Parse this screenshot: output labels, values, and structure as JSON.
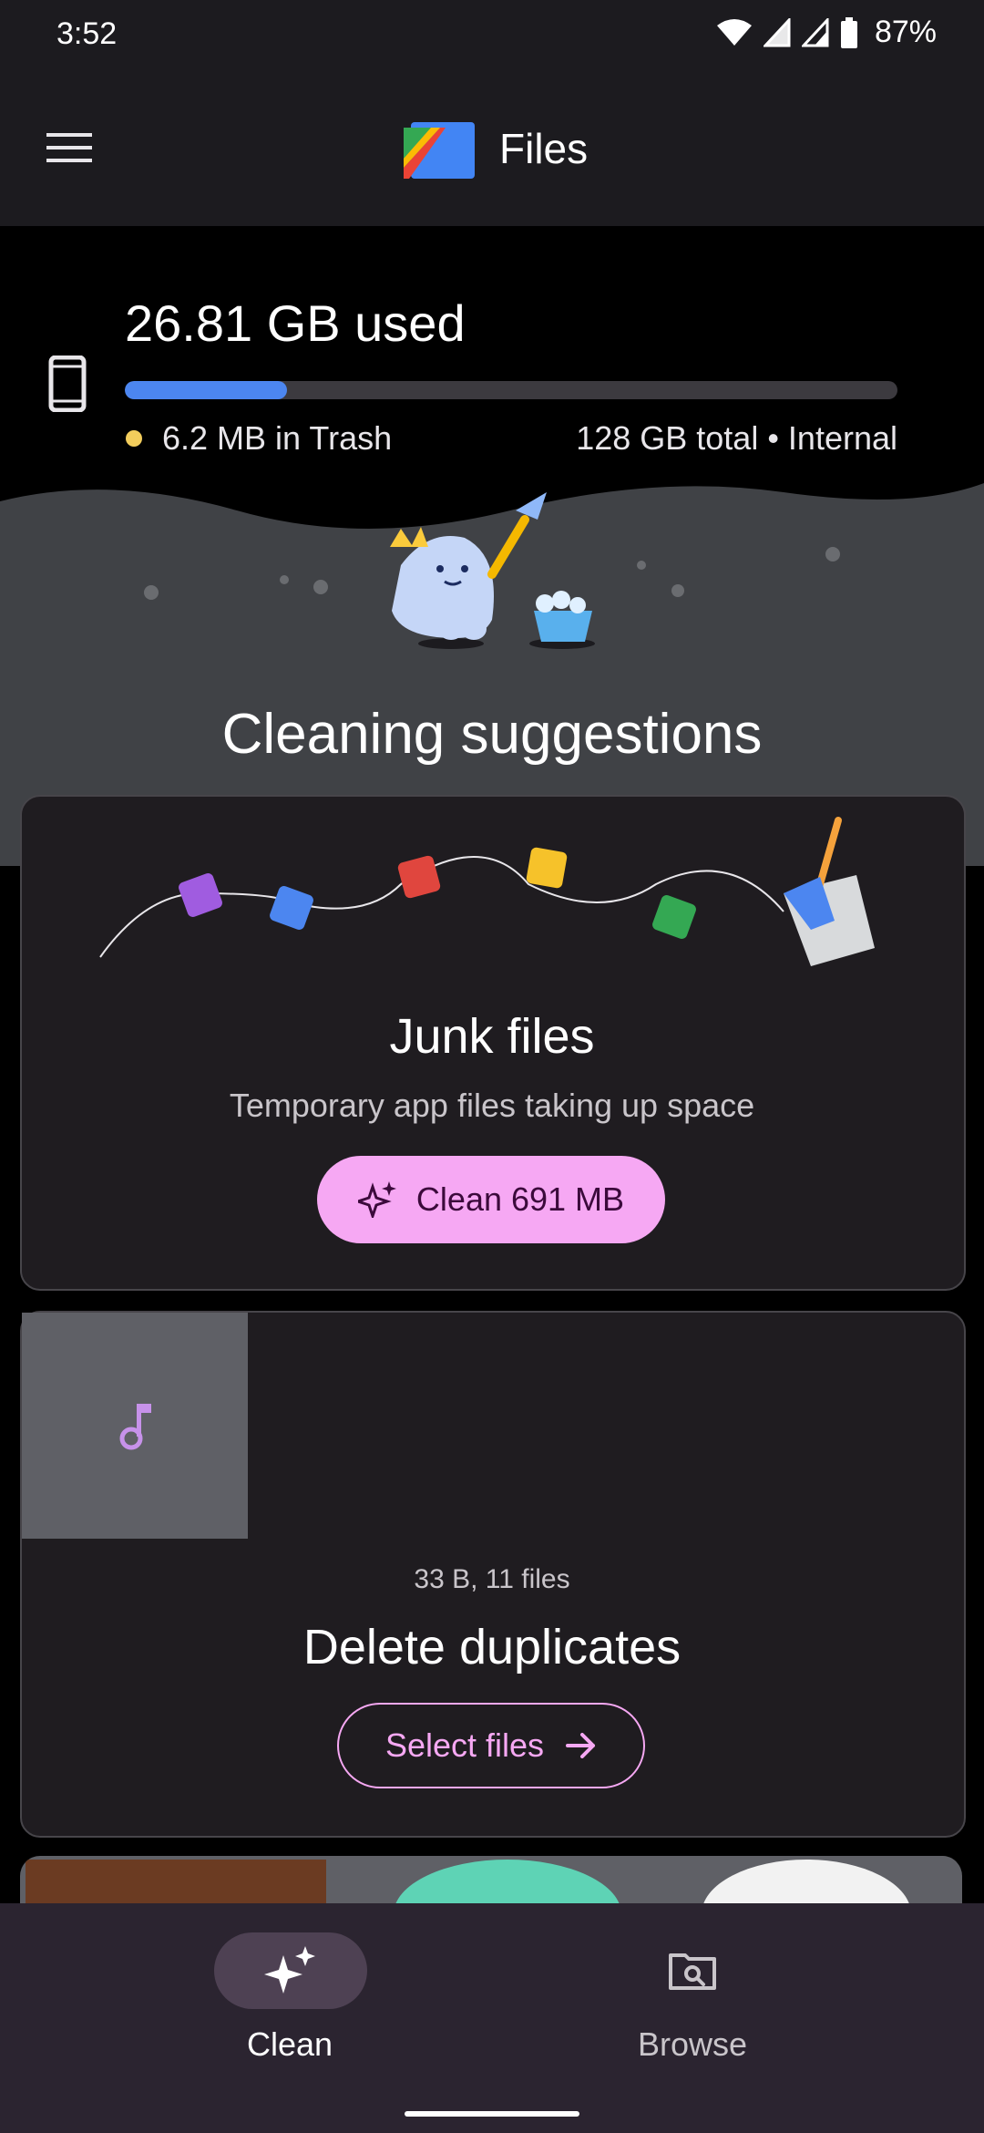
{
  "status_bar": {
    "time": "3:52",
    "battery": "87%"
  },
  "app_bar": {
    "title": "Files"
  },
  "storage": {
    "used_label": "26.81 GB used",
    "used_fraction": 0.21,
    "trash_text": "6.2 MB in Trash",
    "total_text": "128 GB total • Internal"
  },
  "section_title": "Cleaning suggestions",
  "junk_card": {
    "title": "Junk files",
    "subtitle": "Temporary app files taking up space",
    "button_label": "Clean 691 MB"
  },
  "duplicates_card": {
    "meta": "33 B, 11 files",
    "title": "Delete duplicates",
    "button_label": "Select files"
  },
  "bottom_nav": {
    "items": [
      {
        "label": "Clean",
        "icon": "sparkle-icon",
        "selected": true
      },
      {
        "label": "Browse",
        "icon": "browse-search-icon",
        "selected": false
      }
    ]
  },
  "colors": {
    "accent_pink": "#f6a8f3",
    "progress_blue": "#4c86f0",
    "trash_yellow": "#f2cd5c",
    "card_bg": "#1f1c20",
    "nav_bg": "#2b2430"
  }
}
